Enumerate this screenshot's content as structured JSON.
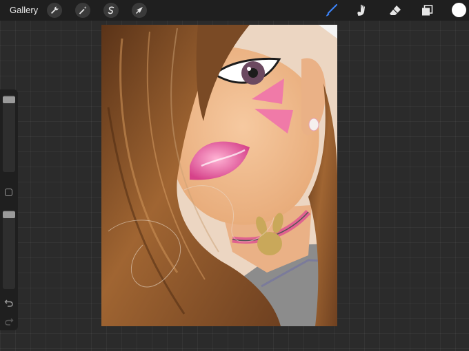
{
  "toolbar": {
    "gallery_label": "Gallery",
    "left_tools": [
      "wrench-icon",
      "magic-wand-icon",
      "selection-icon",
      "transform-arrow-icon"
    ],
    "right_tools": [
      "brush-icon",
      "smudge-icon",
      "eraser-icon",
      "layers-icon"
    ],
    "active_tool": "brush-icon",
    "active_color": "#ffffff",
    "accent": "#3b82f6"
  },
  "sidebar": {
    "brush_size_level": 1.0,
    "opacity_level": 1.0,
    "icons": [
      "modify-square-icon",
      "undo-icon",
      "redo-icon"
    ]
  }
}
